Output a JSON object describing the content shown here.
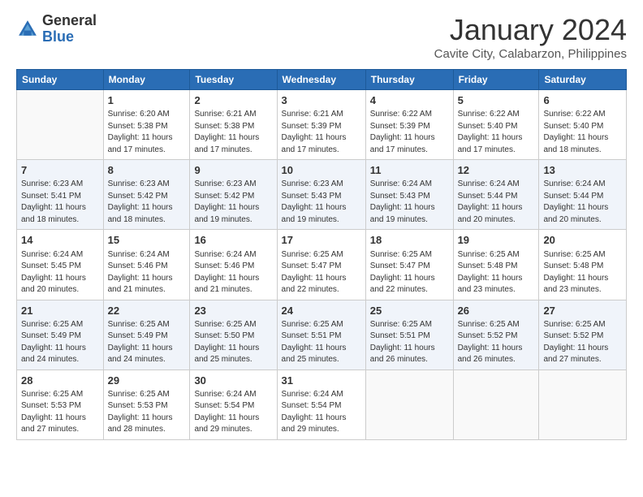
{
  "logo": {
    "general": "General",
    "blue": "Blue"
  },
  "title": "January 2024",
  "location": "Cavite City, Calabarzon, Philippines",
  "days_of_week": [
    "Sunday",
    "Monday",
    "Tuesday",
    "Wednesday",
    "Thursday",
    "Friday",
    "Saturday"
  ],
  "weeks": [
    [
      {
        "day": "",
        "info": ""
      },
      {
        "day": "1",
        "info": "Sunrise: 6:20 AM\nSunset: 5:38 PM\nDaylight: 11 hours\nand 17 minutes."
      },
      {
        "day": "2",
        "info": "Sunrise: 6:21 AM\nSunset: 5:38 PM\nDaylight: 11 hours\nand 17 minutes."
      },
      {
        "day": "3",
        "info": "Sunrise: 6:21 AM\nSunset: 5:39 PM\nDaylight: 11 hours\nand 17 minutes."
      },
      {
        "day": "4",
        "info": "Sunrise: 6:22 AM\nSunset: 5:39 PM\nDaylight: 11 hours\nand 17 minutes."
      },
      {
        "day": "5",
        "info": "Sunrise: 6:22 AM\nSunset: 5:40 PM\nDaylight: 11 hours\nand 17 minutes."
      },
      {
        "day": "6",
        "info": "Sunrise: 6:22 AM\nSunset: 5:40 PM\nDaylight: 11 hours\nand 18 minutes."
      }
    ],
    [
      {
        "day": "7",
        "info": "Sunrise: 6:23 AM\nSunset: 5:41 PM\nDaylight: 11 hours\nand 18 minutes."
      },
      {
        "day": "8",
        "info": "Sunrise: 6:23 AM\nSunset: 5:42 PM\nDaylight: 11 hours\nand 18 minutes."
      },
      {
        "day": "9",
        "info": "Sunrise: 6:23 AM\nSunset: 5:42 PM\nDaylight: 11 hours\nand 19 minutes."
      },
      {
        "day": "10",
        "info": "Sunrise: 6:23 AM\nSunset: 5:43 PM\nDaylight: 11 hours\nand 19 minutes."
      },
      {
        "day": "11",
        "info": "Sunrise: 6:24 AM\nSunset: 5:43 PM\nDaylight: 11 hours\nand 19 minutes."
      },
      {
        "day": "12",
        "info": "Sunrise: 6:24 AM\nSunset: 5:44 PM\nDaylight: 11 hours\nand 20 minutes."
      },
      {
        "day": "13",
        "info": "Sunrise: 6:24 AM\nSunset: 5:44 PM\nDaylight: 11 hours\nand 20 minutes."
      }
    ],
    [
      {
        "day": "14",
        "info": "Sunrise: 6:24 AM\nSunset: 5:45 PM\nDaylight: 11 hours\nand 20 minutes."
      },
      {
        "day": "15",
        "info": "Sunrise: 6:24 AM\nSunset: 5:46 PM\nDaylight: 11 hours\nand 21 minutes."
      },
      {
        "day": "16",
        "info": "Sunrise: 6:24 AM\nSunset: 5:46 PM\nDaylight: 11 hours\nand 21 minutes."
      },
      {
        "day": "17",
        "info": "Sunrise: 6:25 AM\nSunset: 5:47 PM\nDaylight: 11 hours\nand 22 minutes."
      },
      {
        "day": "18",
        "info": "Sunrise: 6:25 AM\nSunset: 5:47 PM\nDaylight: 11 hours\nand 22 minutes."
      },
      {
        "day": "19",
        "info": "Sunrise: 6:25 AM\nSunset: 5:48 PM\nDaylight: 11 hours\nand 23 minutes."
      },
      {
        "day": "20",
        "info": "Sunrise: 6:25 AM\nSunset: 5:48 PM\nDaylight: 11 hours\nand 23 minutes."
      }
    ],
    [
      {
        "day": "21",
        "info": "Sunrise: 6:25 AM\nSunset: 5:49 PM\nDaylight: 11 hours\nand 24 minutes."
      },
      {
        "day": "22",
        "info": "Sunrise: 6:25 AM\nSunset: 5:49 PM\nDaylight: 11 hours\nand 24 minutes."
      },
      {
        "day": "23",
        "info": "Sunrise: 6:25 AM\nSunset: 5:50 PM\nDaylight: 11 hours\nand 25 minutes."
      },
      {
        "day": "24",
        "info": "Sunrise: 6:25 AM\nSunset: 5:51 PM\nDaylight: 11 hours\nand 25 minutes."
      },
      {
        "day": "25",
        "info": "Sunrise: 6:25 AM\nSunset: 5:51 PM\nDaylight: 11 hours\nand 26 minutes."
      },
      {
        "day": "26",
        "info": "Sunrise: 6:25 AM\nSunset: 5:52 PM\nDaylight: 11 hours\nand 26 minutes."
      },
      {
        "day": "27",
        "info": "Sunrise: 6:25 AM\nSunset: 5:52 PM\nDaylight: 11 hours\nand 27 minutes."
      }
    ],
    [
      {
        "day": "28",
        "info": "Sunrise: 6:25 AM\nSunset: 5:53 PM\nDaylight: 11 hours\nand 27 minutes."
      },
      {
        "day": "29",
        "info": "Sunrise: 6:25 AM\nSunset: 5:53 PM\nDaylight: 11 hours\nand 28 minutes."
      },
      {
        "day": "30",
        "info": "Sunrise: 6:24 AM\nSunset: 5:54 PM\nDaylight: 11 hours\nand 29 minutes."
      },
      {
        "day": "31",
        "info": "Sunrise: 6:24 AM\nSunset: 5:54 PM\nDaylight: 11 hours\nand 29 minutes."
      },
      {
        "day": "",
        "info": ""
      },
      {
        "day": "",
        "info": ""
      },
      {
        "day": "",
        "info": ""
      }
    ]
  ]
}
